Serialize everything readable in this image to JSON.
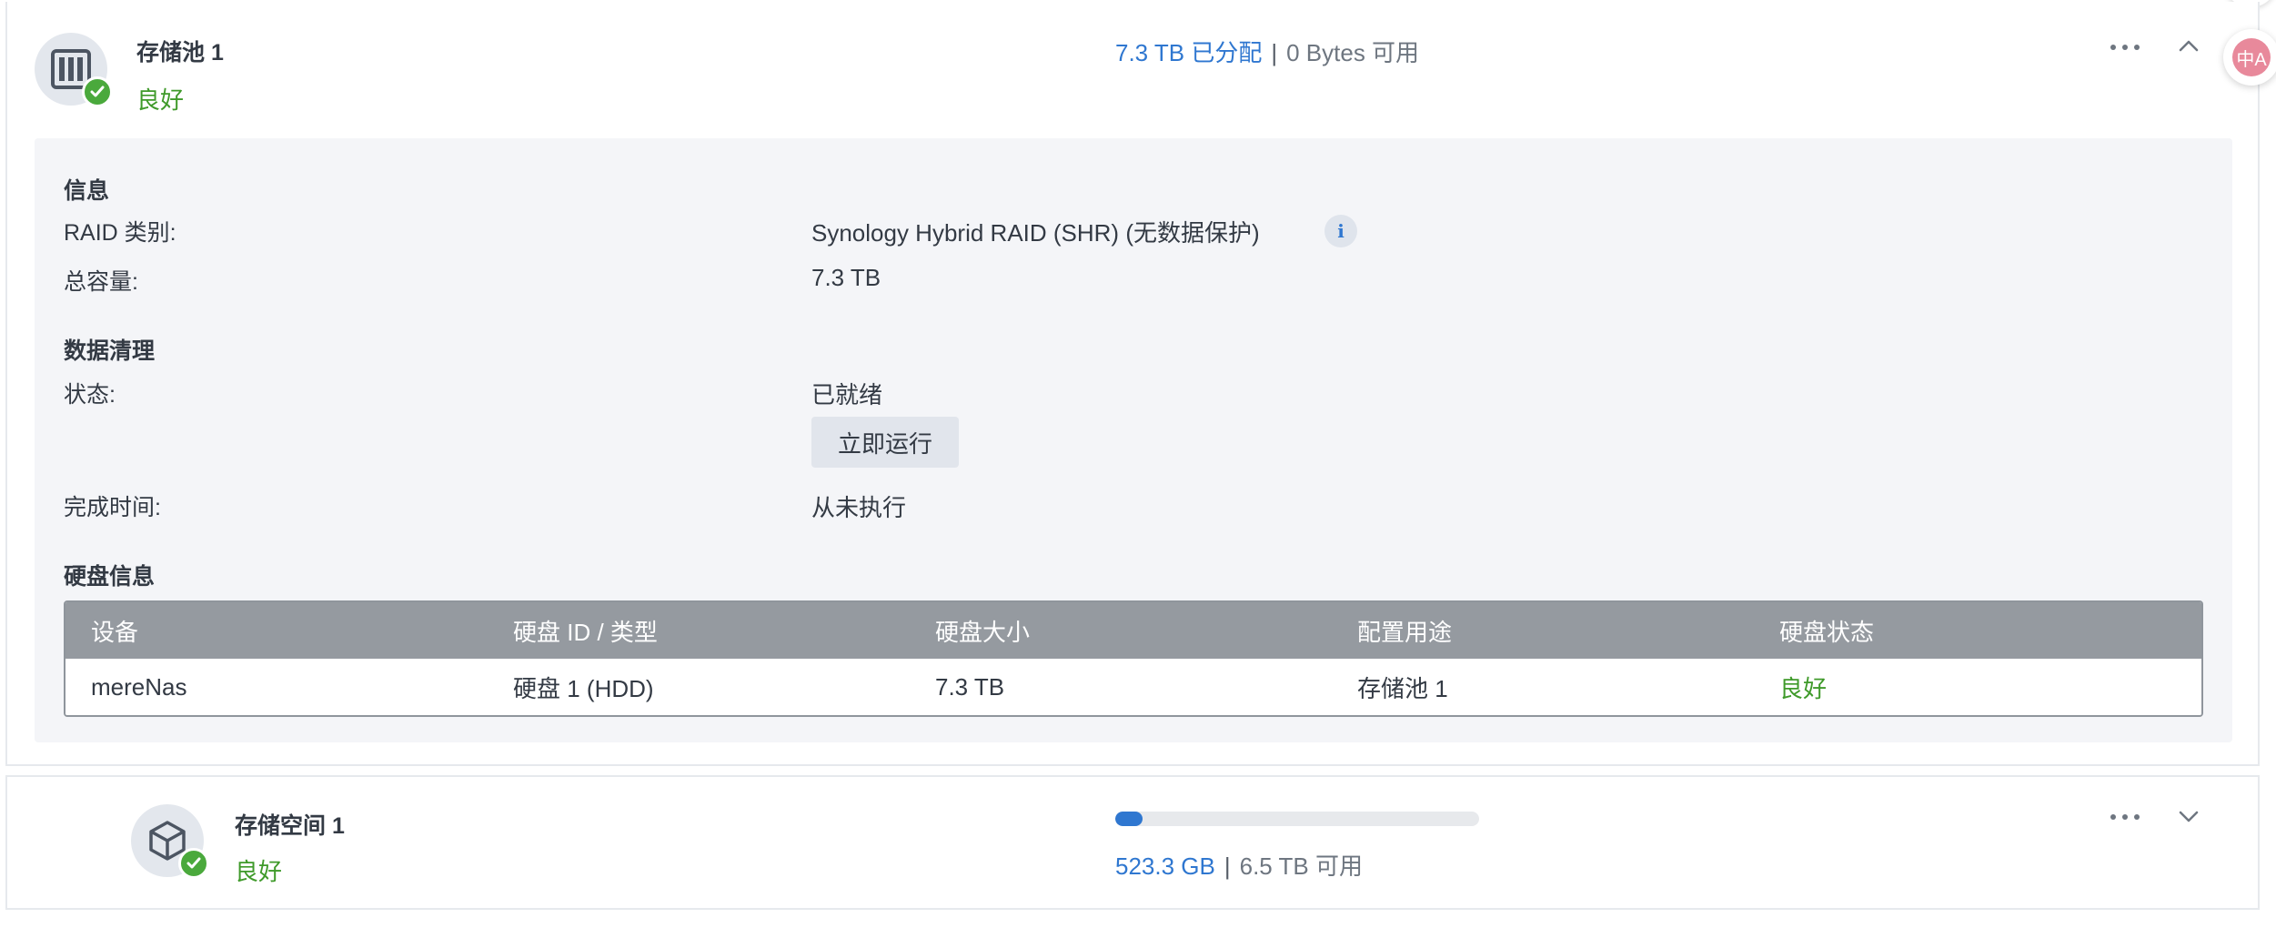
{
  "pool": {
    "title": "存储池 1",
    "status": "良好",
    "allocated": "7.3 TB 已分配",
    "separator": "|",
    "available": "0 Bytes 可用",
    "info": {
      "section_title": "信息",
      "raid_label": "RAID 类别:",
      "raid_value": "Synology Hybrid RAID (SHR) (无数据保护)",
      "capacity_label": "总容量:",
      "capacity_value": "7.3 TB"
    },
    "scrubbing": {
      "section_title": "数据清理",
      "status_label": "状态:",
      "status_value": "已就绪",
      "run_button": "立即运行",
      "finished_label": "完成时间:",
      "finished_value": "从未执行"
    },
    "disks": {
      "section_title": "硬盘信息",
      "headers": [
        "设备",
        "硬盘 ID / 类型",
        "硬盘大小",
        "配置用途",
        "硬盘状态"
      ],
      "rows": [
        [
          "mereNas",
          "硬盘 1 (HDD)",
          "7.3 TB",
          "存储池 1",
          "良好"
        ]
      ]
    }
  },
  "volume": {
    "title": "存储空间 1",
    "status": "良好",
    "used": "523.3 GB",
    "separator": "|",
    "available": "6.5 TB 可用",
    "usage_fraction": 0.075
  },
  "translate_fab_text": "中A",
  "colors": {
    "accent": "#2f77d0",
    "good": "#3f9a2a",
    "table_header": "#959aa0"
  }
}
